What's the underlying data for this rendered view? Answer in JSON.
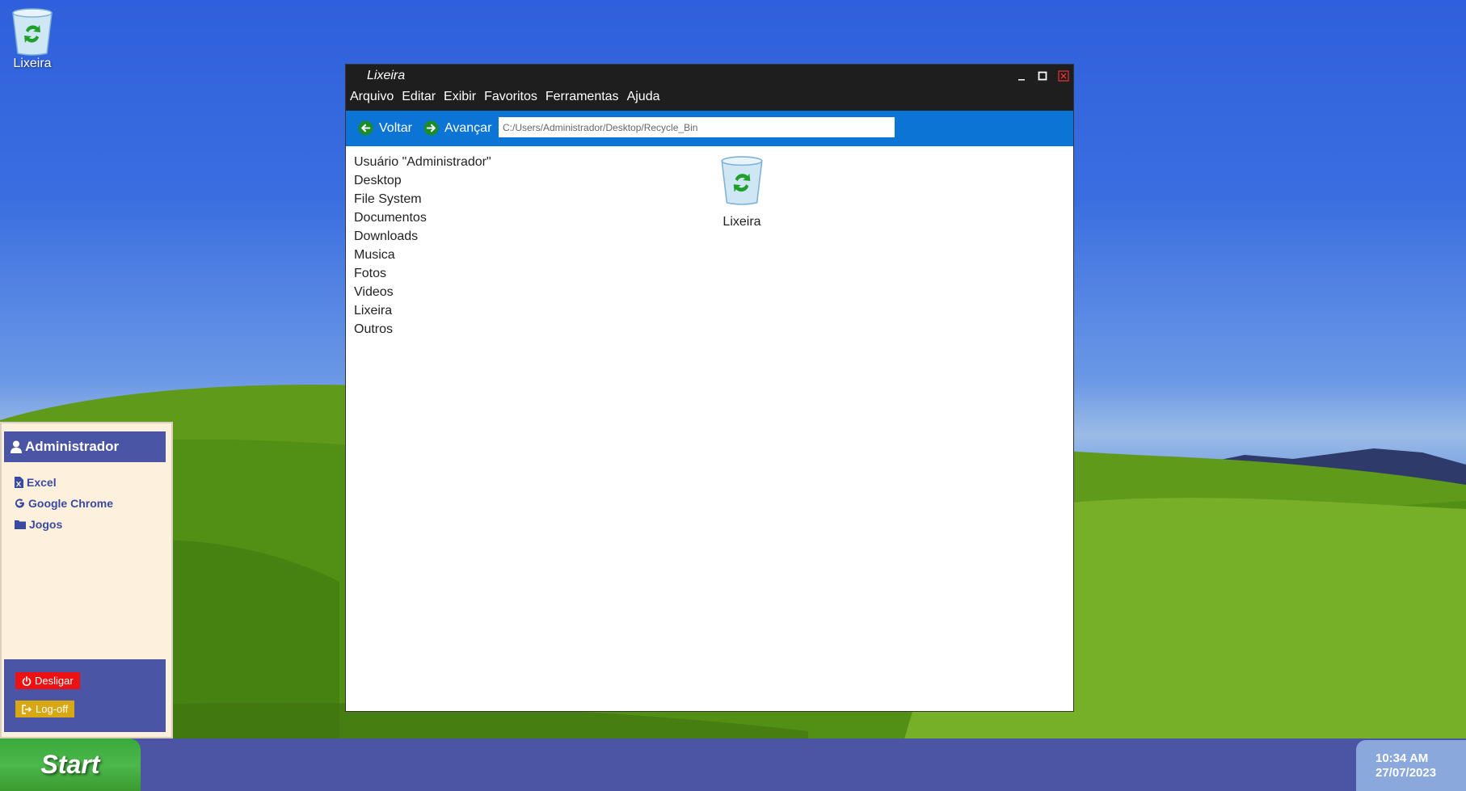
{
  "desktop": {
    "icon_label": "Lixeira"
  },
  "window": {
    "title": "Lixeira",
    "controls": {
      "minimize": "_",
      "maximize": "□",
      "close": "✕"
    },
    "menu": [
      "Arquivo",
      "Editar",
      "Exibir",
      "Favoritos",
      "Ferramentas",
      "Ajuda"
    ],
    "toolbar": {
      "back_label": "Voltar",
      "forward_label": "Avançar",
      "address_value": "C:/Users/Administrador/Desktop/Recycle_Bin"
    },
    "sidebar": [
      "Usuário \"Administrador\"",
      "Desktop",
      "File System",
      "Documentos",
      "Downloads",
      "Musica",
      "Fotos",
      "Videos",
      "Lixeira",
      "Outros"
    ],
    "content": {
      "item_label": "Lixeira"
    }
  },
  "start_menu": {
    "user": "Administrador",
    "items": [
      {
        "label": "Excel",
        "icon": "excel-file-icon"
      },
      {
        "label": "Google Chrome",
        "icon": "google-icon"
      },
      {
        "label": "Jogos",
        "icon": "folder-icon"
      }
    ],
    "shutdown_label": "Desligar",
    "logoff_label": "Log-off"
  },
  "taskbar": {
    "start_label": "Start",
    "time": "10:34 AM",
    "date": "27/07/2023"
  },
  "colors": {
    "accent_blue": "#0b74d4",
    "taskbar": "#4b55a3",
    "start_green": "#4cb84c",
    "shutdown_red": "#ee1111",
    "logoff_yellow": "#d8a814"
  }
}
